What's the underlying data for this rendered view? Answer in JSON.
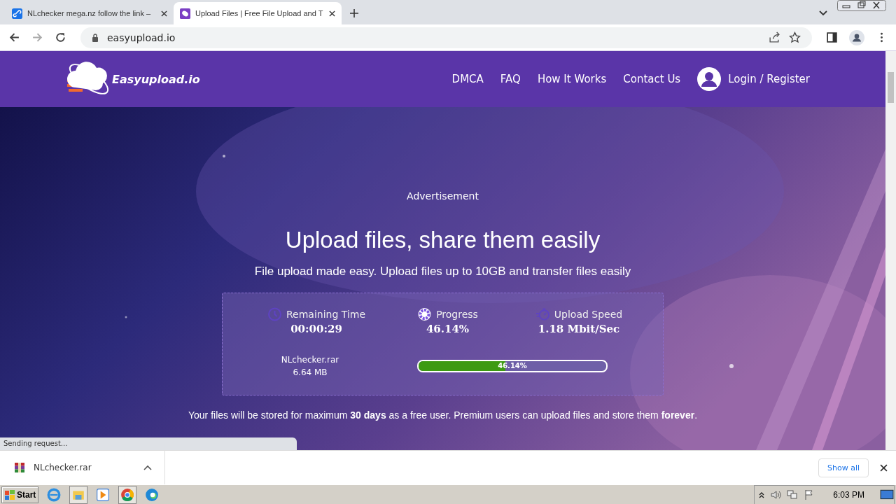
{
  "browser": {
    "tabs": [
      {
        "title": "NLchecker mega.nz follow the link –",
        "selected": false
      },
      {
        "title": "Upload Files | Free File Upload and T",
        "selected": true
      }
    ],
    "address": "easyupload.io"
  },
  "site": {
    "logo": "Easyupload.io",
    "nav": [
      "DMCA",
      "FAQ",
      "How It Works",
      "Contact Us"
    ],
    "login": "Login / Register"
  },
  "hero": {
    "ad": "Advertisement",
    "title": "Upload files, share them easily",
    "subtitle": "File upload made easy. Upload files up to 10GB and transfer files easily",
    "stats": [
      {
        "kind": "time",
        "label": "Remaining Time",
        "value": "00:00:29"
      },
      {
        "kind": "progress",
        "label": "Progress",
        "value": "46.14%"
      },
      {
        "kind": "speed",
        "label": "Upload Speed",
        "value": "1.18 Mbit/Sec"
      }
    ],
    "file": {
      "name": "NLchecker.rar",
      "size": "6.64 MB"
    },
    "progress": {
      "level": 0.4614,
      "text": "46.14%"
    },
    "note": "Your files will be stored for maximum **30 days** as a free user. Premium users can upload files and store them **forever**."
  },
  "status_bubble": "Sending request...",
  "downloads": {
    "file": "NLchecker.rar",
    "show_all": "Show all"
  },
  "taskbar": {
    "start": "Start",
    "clock": "6:03 PM"
  }
}
